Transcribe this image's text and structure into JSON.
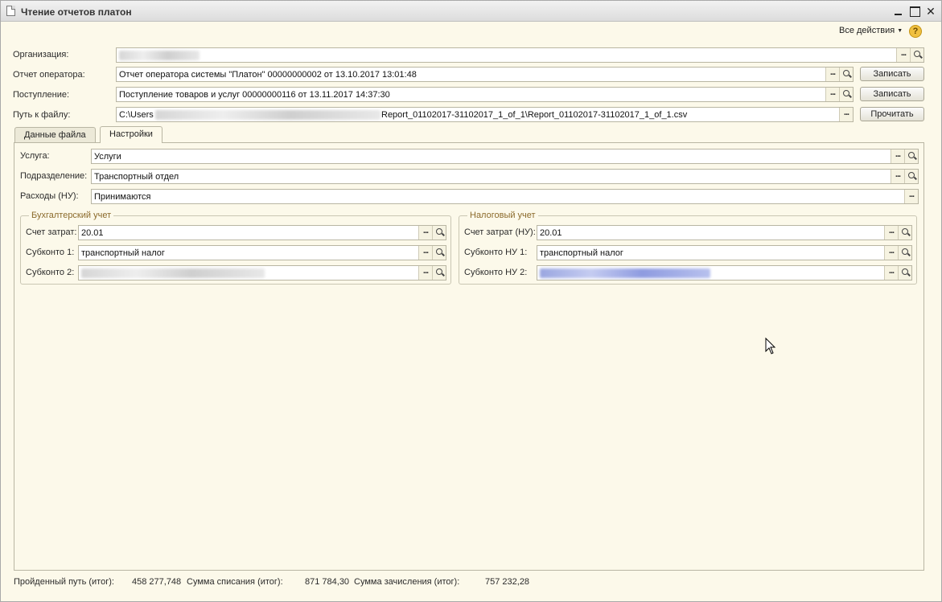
{
  "window": {
    "title": "Чтение отчетов платон"
  },
  "toolbar": {
    "all_actions": "Все действия",
    "help": "?"
  },
  "form": {
    "organization_label": "Организация:",
    "operator_report_label": "Отчет оператора:",
    "operator_report_value": "Отчет оператора системы \"Платон\" 00000000002 от 13.10.2017 13:01:48",
    "receipt_label": "Поступление:",
    "receipt_value": "Поступление товаров и услуг 00000000116 от 13.11.2017 14:37:30",
    "file_path_label": "Путь к файлу:",
    "file_path_prefix": "C:\\Users",
    "file_path_suffix": "Report_01102017-31102017_1_of_1\\Report_01102017-31102017_1_of_1.csv",
    "save_button_1": "Записать",
    "save_button_2": "Записать",
    "read_button": "Прочитать"
  },
  "tabs": [
    {
      "label": "Данные файла",
      "active": false
    },
    {
      "label": "Настройки",
      "active": true
    }
  ],
  "settings": {
    "service_label": "Услуга:",
    "service_value": "Услуги",
    "division_label": "Подразделение:",
    "division_value": "Транспортный отдел",
    "expenses_label": "Расходы (НУ):",
    "expenses_value": "Принимаются",
    "accounting": {
      "title": "Бухгалтерский учет",
      "cost_account_label": "Счет затрат:",
      "cost_account_value": "20.01",
      "subconto1_label": "Субконто 1:",
      "subconto1_value": "транспортный налог",
      "subconto2_label": "Субконто 2:"
    },
    "tax": {
      "title": "Налоговый учет",
      "cost_account_label": "Счет затрат (НУ):",
      "cost_account_value": "20.01",
      "subconto1_label": "Субконто НУ 1:",
      "subconto1_value": "транспортный налог",
      "subconto2_label": "Субконто НУ 2:"
    }
  },
  "footer": {
    "path_total_label": "Пройденный путь (итог):",
    "path_total_value": "458 277,748",
    "writeoff_total_label": "Сумма списания (итог):",
    "writeoff_total_value": "871 784,30",
    "credit_total_label": "Сумма зачисления (итог):",
    "credit_total_value": "757 232,28"
  }
}
